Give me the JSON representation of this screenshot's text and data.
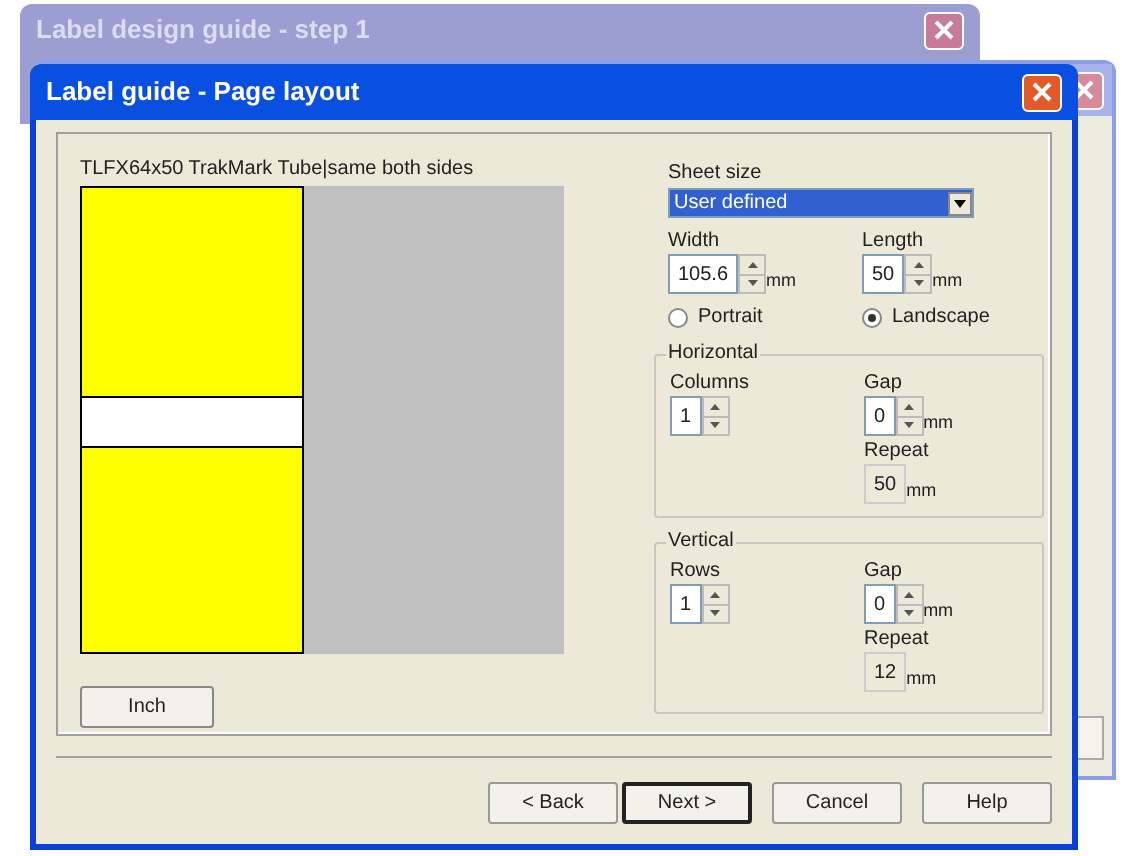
{
  "background_window": {
    "title": "Label design guide - step 1"
  },
  "dialog": {
    "title": "Label guide - Page layout",
    "preview": {
      "caption": "TLFX64x50 TrakMark Tube|same both sides"
    },
    "unit_button": "Inch",
    "sheet_size": {
      "label": "Sheet size",
      "value": "User defined"
    },
    "width": {
      "label": "Width",
      "value": "105.6",
      "unit": "mm"
    },
    "length": {
      "label": "Length",
      "value": "50",
      "unit": "mm"
    },
    "orientation": [
      {
        "label": "Portrait",
        "selected": false
      },
      {
        "label": "Landscape",
        "selected": true
      }
    ],
    "groups": [
      {
        "title": "Horizontal",
        "count_label": "Columns",
        "count": "1",
        "gap_label": "Gap",
        "gap": "0",
        "gap_unit": "mm",
        "repeat_label": "Repeat",
        "repeat": "50",
        "repeat_unit": "mm"
      },
      {
        "title": "Vertical",
        "count_label": "Rows",
        "count": "1",
        "gap_label": "Gap",
        "gap": "0",
        "gap_unit": "mm",
        "repeat_label": "Repeat",
        "repeat": "12",
        "repeat_unit": "mm"
      }
    ],
    "buttons": [
      {
        "label": "< Back",
        "default": false
      },
      {
        "label": "Next >",
        "default": true
      },
      {
        "label": "Cancel",
        "default": false
      },
      {
        "label": "Help",
        "default": false
      }
    ]
  }
}
